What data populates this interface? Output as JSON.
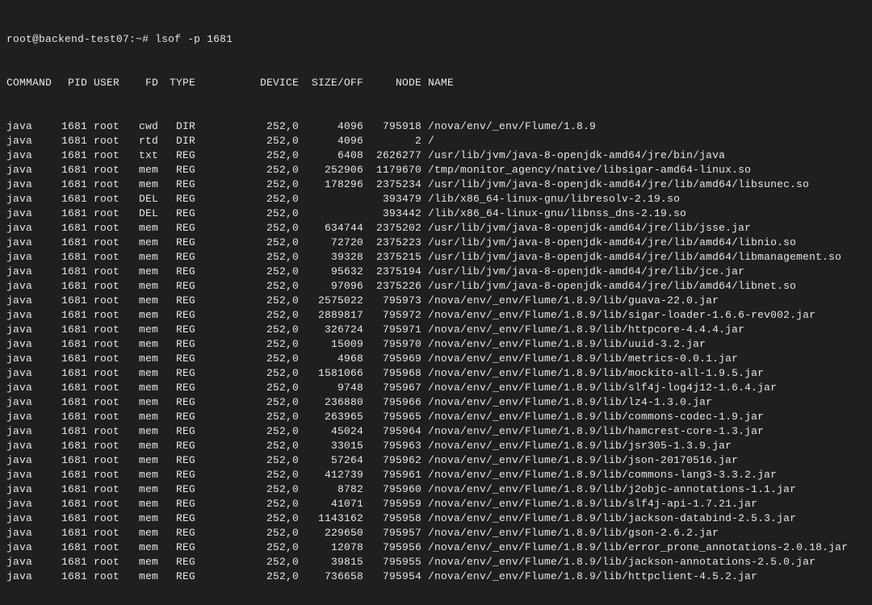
{
  "prompt": {
    "user_host": "root@backend-test07",
    "cwd": "~",
    "symbol": "#",
    "command": "lsof -p 1681"
  },
  "header": {
    "cmd": "COMMAND",
    "pid": "PID",
    "user": "USER",
    "fd": "FD",
    "type": "TYPE",
    "device": "DEVICE",
    "size": "SIZE/OFF",
    "node": "NODE",
    "name": "NAME"
  },
  "rows": [
    {
      "cmd": "java",
      "pid": "1681",
      "user": "root",
      "fd": "cwd",
      "type": "DIR",
      "device": "252,0",
      "size": "4096",
      "node": "795918",
      "name": "/nova/env/_env/Flume/1.8.9"
    },
    {
      "cmd": "java",
      "pid": "1681",
      "user": "root",
      "fd": "rtd",
      "type": "DIR",
      "device": "252,0",
      "size": "4096",
      "node": "2",
      "name": "/"
    },
    {
      "cmd": "java",
      "pid": "1681",
      "user": "root",
      "fd": "txt",
      "type": "REG",
      "device": "252,0",
      "size": "6408",
      "node": "2626277",
      "name": "/usr/lib/jvm/java-8-openjdk-amd64/jre/bin/java"
    },
    {
      "cmd": "java",
      "pid": "1681",
      "user": "root",
      "fd": "mem",
      "type": "REG",
      "device": "252,0",
      "size": "252906",
      "node": "1179670",
      "name": "/tmp/monitor_agency/native/libsigar-amd64-linux.so"
    },
    {
      "cmd": "java",
      "pid": "1681",
      "user": "root",
      "fd": "mem",
      "type": "REG",
      "device": "252,0",
      "size": "178296",
      "node": "2375234",
      "name": "/usr/lib/jvm/java-8-openjdk-amd64/jre/lib/amd64/libsunec.so"
    },
    {
      "cmd": "java",
      "pid": "1681",
      "user": "root",
      "fd": "DEL",
      "type": "REG",
      "device": "252,0",
      "size": "",
      "node": "393479",
      "name": "/lib/x86_64-linux-gnu/libresolv-2.19.so"
    },
    {
      "cmd": "java",
      "pid": "1681",
      "user": "root",
      "fd": "DEL",
      "type": "REG",
      "device": "252,0",
      "size": "",
      "node": "393442",
      "name": "/lib/x86_64-linux-gnu/libnss_dns-2.19.so"
    },
    {
      "cmd": "java",
      "pid": "1681",
      "user": "root",
      "fd": "mem",
      "type": "REG",
      "device": "252,0",
      "size": "634744",
      "node": "2375202",
      "name": "/usr/lib/jvm/java-8-openjdk-amd64/jre/lib/jsse.jar"
    },
    {
      "cmd": "java",
      "pid": "1681",
      "user": "root",
      "fd": "mem",
      "type": "REG",
      "device": "252,0",
      "size": "72720",
      "node": "2375223",
      "name": "/usr/lib/jvm/java-8-openjdk-amd64/jre/lib/amd64/libnio.so"
    },
    {
      "cmd": "java",
      "pid": "1681",
      "user": "root",
      "fd": "mem",
      "type": "REG",
      "device": "252,0",
      "size": "39328",
      "node": "2375215",
      "name": "/usr/lib/jvm/java-8-openjdk-amd64/jre/lib/amd64/libmanagement.so"
    },
    {
      "cmd": "java",
      "pid": "1681",
      "user": "root",
      "fd": "mem",
      "type": "REG",
      "device": "252,0",
      "size": "95632",
      "node": "2375194",
      "name": "/usr/lib/jvm/java-8-openjdk-amd64/jre/lib/jce.jar"
    },
    {
      "cmd": "java",
      "pid": "1681",
      "user": "root",
      "fd": "mem",
      "type": "REG",
      "device": "252,0",
      "size": "97096",
      "node": "2375226",
      "name": "/usr/lib/jvm/java-8-openjdk-amd64/jre/lib/amd64/libnet.so"
    },
    {
      "cmd": "java",
      "pid": "1681",
      "user": "root",
      "fd": "mem",
      "type": "REG",
      "device": "252,0",
      "size": "2575022",
      "node": "795973",
      "name": "/nova/env/_env/Flume/1.8.9/lib/guava-22.0.jar"
    },
    {
      "cmd": "java",
      "pid": "1681",
      "user": "root",
      "fd": "mem",
      "type": "REG",
      "device": "252,0",
      "size": "2889817",
      "node": "795972",
      "name": "/nova/env/_env/Flume/1.8.9/lib/sigar-loader-1.6.6-rev002.jar"
    },
    {
      "cmd": "java",
      "pid": "1681",
      "user": "root",
      "fd": "mem",
      "type": "REG",
      "device": "252,0",
      "size": "326724",
      "node": "795971",
      "name": "/nova/env/_env/Flume/1.8.9/lib/httpcore-4.4.4.jar"
    },
    {
      "cmd": "java",
      "pid": "1681",
      "user": "root",
      "fd": "mem",
      "type": "REG",
      "device": "252,0",
      "size": "15009",
      "node": "795970",
      "name": "/nova/env/_env/Flume/1.8.9/lib/uuid-3.2.jar"
    },
    {
      "cmd": "java",
      "pid": "1681",
      "user": "root",
      "fd": "mem",
      "type": "REG",
      "device": "252,0",
      "size": "4968",
      "node": "795969",
      "name": "/nova/env/_env/Flume/1.8.9/lib/metrics-0.0.1.jar"
    },
    {
      "cmd": "java",
      "pid": "1681",
      "user": "root",
      "fd": "mem",
      "type": "REG",
      "device": "252,0",
      "size": "1581066",
      "node": "795968",
      "name": "/nova/env/_env/Flume/1.8.9/lib/mockito-all-1.9.5.jar"
    },
    {
      "cmd": "java",
      "pid": "1681",
      "user": "root",
      "fd": "mem",
      "type": "REG",
      "device": "252,0",
      "size": "9748",
      "node": "795967",
      "name": "/nova/env/_env/Flume/1.8.9/lib/slf4j-log4j12-1.6.4.jar"
    },
    {
      "cmd": "java",
      "pid": "1681",
      "user": "root",
      "fd": "mem",
      "type": "REG",
      "device": "252,0",
      "size": "236880",
      "node": "795966",
      "name": "/nova/env/_env/Flume/1.8.9/lib/lz4-1.3.0.jar"
    },
    {
      "cmd": "java",
      "pid": "1681",
      "user": "root",
      "fd": "mem",
      "type": "REG",
      "device": "252,0",
      "size": "263965",
      "node": "795965",
      "name": "/nova/env/_env/Flume/1.8.9/lib/commons-codec-1.9.jar"
    },
    {
      "cmd": "java",
      "pid": "1681",
      "user": "root",
      "fd": "mem",
      "type": "REG",
      "device": "252,0",
      "size": "45024",
      "node": "795964",
      "name": "/nova/env/_env/Flume/1.8.9/lib/hamcrest-core-1.3.jar"
    },
    {
      "cmd": "java",
      "pid": "1681",
      "user": "root",
      "fd": "mem",
      "type": "REG",
      "device": "252,0",
      "size": "33015",
      "node": "795963",
      "name": "/nova/env/_env/Flume/1.8.9/lib/jsr305-1.3.9.jar"
    },
    {
      "cmd": "java",
      "pid": "1681",
      "user": "root",
      "fd": "mem",
      "type": "REG",
      "device": "252,0",
      "size": "57264",
      "node": "795962",
      "name": "/nova/env/_env/Flume/1.8.9/lib/json-20170516.jar"
    },
    {
      "cmd": "java",
      "pid": "1681",
      "user": "root",
      "fd": "mem",
      "type": "REG",
      "device": "252,0",
      "size": "412739",
      "node": "795961",
      "name": "/nova/env/_env/Flume/1.8.9/lib/commons-lang3-3.3.2.jar"
    },
    {
      "cmd": "java",
      "pid": "1681",
      "user": "root",
      "fd": "mem",
      "type": "REG",
      "device": "252,0",
      "size": "8782",
      "node": "795960",
      "name": "/nova/env/_env/Flume/1.8.9/lib/j2objc-annotations-1.1.jar"
    },
    {
      "cmd": "java",
      "pid": "1681",
      "user": "root",
      "fd": "mem",
      "type": "REG",
      "device": "252,0",
      "size": "41071",
      "node": "795959",
      "name": "/nova/env/_env/Flume/1.8.9/lib/slf4j-api-1.7.21.jar"
    },
    {
      "cmd": "java",
      "pid": "1681",
      "user": "root",
      "fd": "mem",
      "type": "REG",
      "device": "252,0",
      "size": "1143162",
      "node": "795958",
      "name": "/nova/env/_env/Flume/1.8.9/lib/jackson-databind-2.5.3.jar"
    },
    {
      "cmd": "java",
      "pid": "1681",
      "user": "root",
      "fd": "mem",
      "type": "REG",
      "device": "252,0",
      "size": "229650",
      "node": "795957",
      "name": "/nova/env/_env/Flume/1.8.9/lib/gson-2.6.2.jar"
    },
    {
      "cmd": "java",
      "pid": "1681",
      "user": "root",
      "fd": "mem",
      "type": "REG",
      "device": "252,0",
      "size": "12078",
      "node": "795956",
      "name": "/nova/env/_env/Flume/1.8.9/lib/error_prone_annotations-2.0.18.jar"
    },
    {
      "cmd": "java",
      "pid": "1681",
      "user": "root",
      "fd": "mem",
      "type": "REG",
      "device": "252,0",
      "size": "39815",
      "node": "795955",
      "name": "/nova/env/_env/Flume/1.8.9/lib/jackson-annotations-2.5.0.jar"
    },
    {
      "cmd": "java",
      "pid": "1681",
      "user": "root",
      "fd": "mem",
      "type": "REG",
      "device": "252,0",
      "size": "736658",
      "node": "795954",
      "name": "/nova/env/_env/Flume/1.8.9/lib/httpclient-4.5.2.jar"
    }
  ]
}
